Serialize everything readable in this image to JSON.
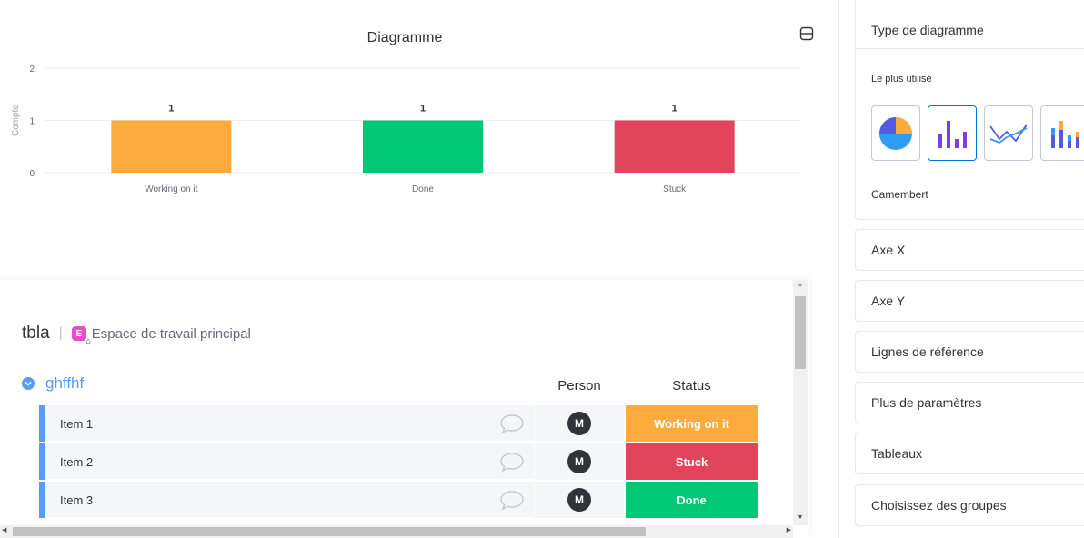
{
  "chart_widget": {
    "title": "Diagramme",
    "collapse_icon": "collapse-icon"
  },
  "chart_data": {
    "type": "bar",
    "categories": [
      "Working on it",
      "Done",
      "Stuck"
    ],
    "values": [
      1,
      1,
      1
    ],
    "data_labels": [
      "1",
      "1",
      "1"
    ],
    "colors": [
      "#fdab3d",
      "#00c875",
      "#e2445c"
    ],
    "title": "Diagramme",
    "xlabel": "",
    "ylabel": "Compte",
    "ylim": [
      0,
      2
    ],
    "yticks": [
      "0",
      "1",
      "2"
    ],
    "grid": true,
    "legend": "none"
  },
  "board": {
    "name": "tbla",
    "separator": "|",
    "workspace_badge": "E",
    "workspace_name": "Espace de travail principal",
    "group": {
      "name": "ghffhf",
      "color": "#579bfc"
    },
    "columns": {
      "person": "Person",
      "status": "Status"
    },
    "rows": [
      {
        "name": "Item 1",
        "person": "M",
        "status": "Working on it",
        "status_color": "#fdab3d"
      },
      {
        "name": "Item 2",
        "person": "M",
        "status": "Stuck",
        "status_color": "#e2445c"
      },
      {
        "name": "Item 3",
        "person": "M",
        "status": "Done",
        "status_color": "#00c875"
      }
    ]
  },
  "settings_panel": {
    "chart_type": {
      "title": "Type de diagramme",
      "most_used": "Le plus utilisé",
      "options": [
        {
          "icon": "pie-chart-icon",
          "name": "Camembert"
        },
        {
          "icon": "bar-chart-icon",
          "selected": true
        },
        {
          "icon": "line-chart-icon"
        },
        {
          "icon": "stacked-bar-chart-icon"
        }
      ],
      "hovered_name": "Camembert"
    },
    "sections": [
      "Axe X",
      "Axe Y",
      "Lignes de référence",
      "Plus de paramètres",
      "Tableaux",
      "Choisissez des groupes"
    ]
  }
}
